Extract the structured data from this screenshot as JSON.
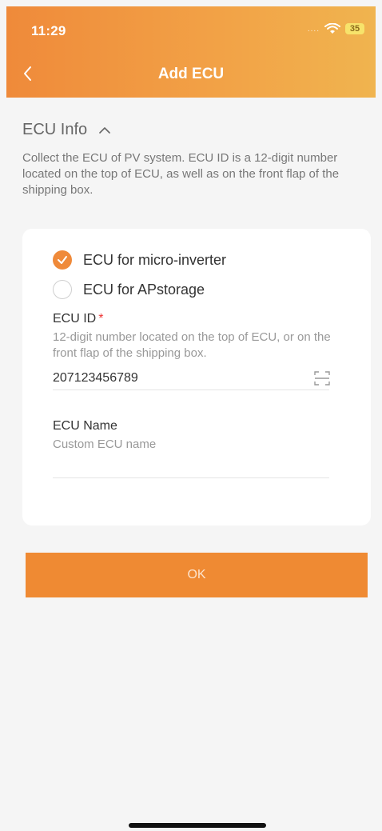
{
  "status_bar": {
    "time": "11:29",
    "battery": "35"
  },
  "header": {
    "title": "Add ECU"
  },
  "section": {
    "title": "ECU Info",
    "description": "Collect the ECU of PV system. ECU ID is a 12-digit number located on the top of ECU, as well as on the front flap of the shipping box."
  },
  "form": {
    "options": [
      {
        "label": "ECU for micro-inverter",
        "selected": true
      },
      {
        "label": "ECU for APstorage",
        "selected": false
      }
    ],
    "ecu_id": {
      "label": "ECU ID",
      "required_mark": "*",
      "hint": "12-digit number located on the top of ECU, or on the front flap of the shipping box.",
      "value": "207123456789"
    },
    "ecu_name": {
      "label": "ECU Name",
      "placeholder": "Custom ECU name",
      "value": ""
    }
  },
  "actions": {
    "ok_label": "OK"
  },
  "colors": {
    "accent": "#ef8a3a",
    "background": "#f5f5f5"
  },
  "icons": [
    "chevron-left-icon",
    "chevron-up-icon",
    "check-icon",
    "scan-icon",
    "wifi-icon"
  ]
}
